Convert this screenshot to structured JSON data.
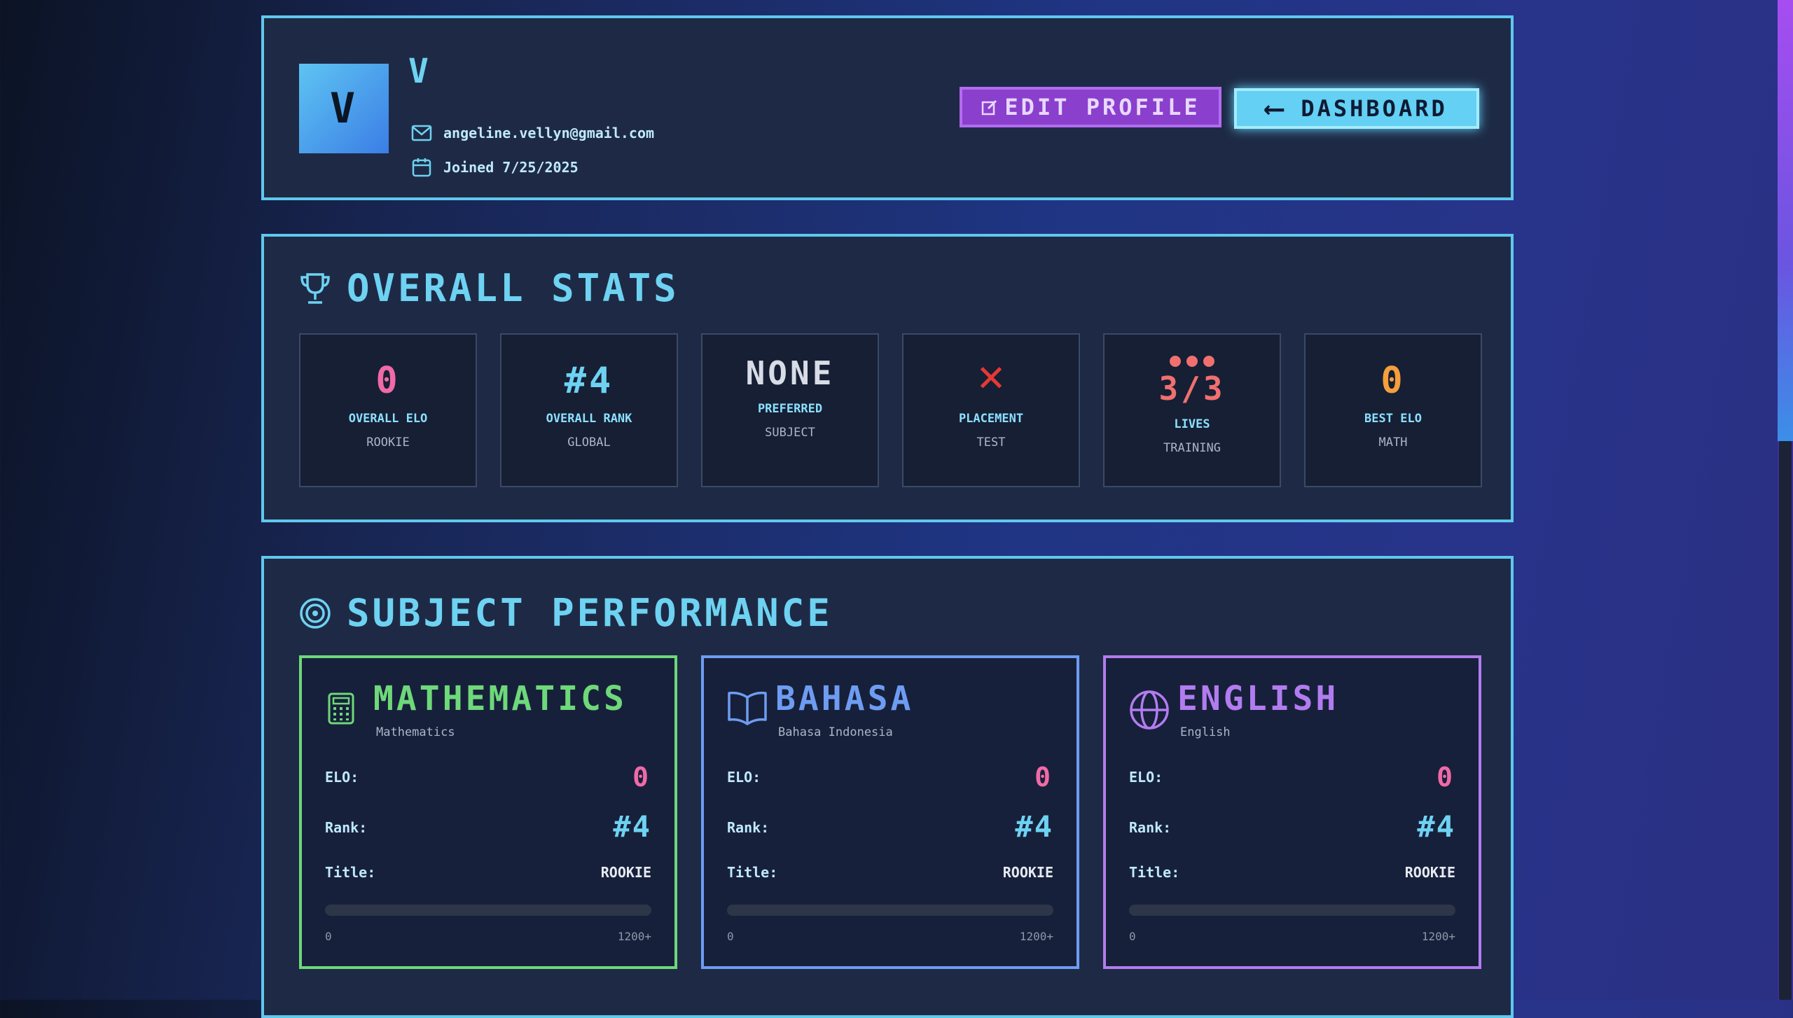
{
  "profile": {
    "avatar_glyph": "V",
    "username_glyph": "V",
    "email": "angeline.vellyn@gmail.com",
    "joined": "Joined 7/25/2025",
    "edit_label": "EDIT PROFILE",
    "dashboard_label": "DASHBOARD",
    "dashboard_arrow": "⟵"
  },
  "stats": {
    "title": "OVERALL STATS",
    "items": [
      {
        "value": "0",
        "label": "OVERALL ELO",
        "sub": "ROOKIE",
        "color": "#f06aa8"
      },
      {
        "value": "#4",
        "label": "OVERALL RANK",
        "sub": "GLOBAL",
        "color": "#6ed2f2"
      },
      {
        "value": "NONE",
        "label": "PREFERRED",
        "sub": "SUBJECT",
        "color": "#d8dce6"
      },
      {
        "value": "✕",
        "label": "PLACEMENT",
        "sub": "TEST",
        "color": "#e53935"
      },
      {
        "value": "3/3",
        "label": "LIVES",
        "sub": "TRAINING",
        "color": "#f07070"
      },
      {
        "value": "0",
        "label": "BEST ELO",
        "sub": "MATH",
        "color": "#f59e3c"
      }
    ]
  },
  "subjects": {
    "title": "SUBJECT PERFORMANCE",
    "row_labels": {
      "elo": "ELO:",
      "rank": "Rank:",
      "title": "Title:"
    },
    "scale": {
      "min": "0",
      "max": "1200+"
    },
    "items": [
      {
        "name": "MATHEMATICS",
        "full": "Mathematics",
        "elo": "0",
        "rank": "#4",
        "title": "ROOKIE",
        "progress": 0,
        "color": "#6ed87a",
        "icon": "calculator-icon"
      },
      {
        "name": "BAHASA",
        "full": "Bahasa Indonesia",
        "elo": "0",
        "rank": "#4",
        "title": "ROOKIE",
        "progress": 0,
        "color": "#6e9cf2",
        "icon": "book-icon"
      },
      {
        "name": "ENGLISH",
        "full": "English",
        "elo": "0",
        "rank": "#4",
        "title": "ROOKIE",
        "progress": 0,
        "color": "#b27cf0",
        "icon": "globe-icon"
      }
    ]
  },
  "colors": {
    "accent": "#6ed2f2",
    "elo": "#f06aa8",
    "purple": "#8a3fcd"
  }
}
